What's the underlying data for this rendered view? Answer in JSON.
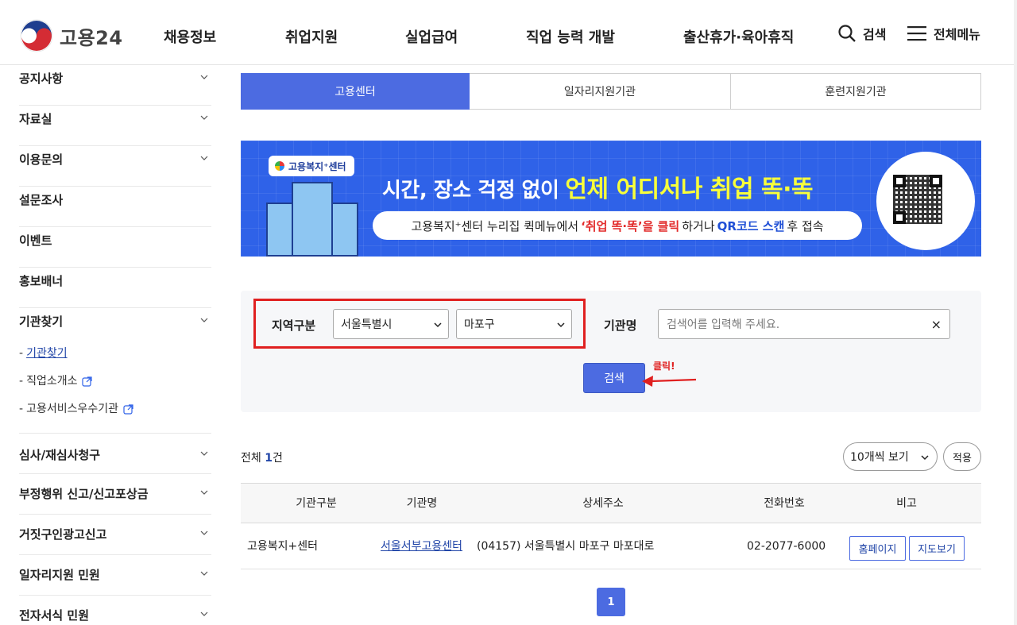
{
  "header": {
    "logo_text": "고용24",
    "nav": [
      "채용정보",
      "취업지원",
      "실업급여",
      "직업 능력 개발",
      "출산휴가·육아휴직"
    ],
    "search_label": "검색",
    "menu_label": "전체메뉴"
  },
  "sidebar": {
    "items": [
      {
        "label": "공지사항"
      },
      {
        "label": "자료실"
      },
      {
        "label": "이용문의"
      },
      {
        "label": "설문조사"
      },
      {
        "label": "이벤트"
      },
      {
        "label": "홍보배너"
      },
      {
        "label": "기관찾기"
      }
    ],
    "sub": [
      {
        "label": "기관찾기"
      },
      {
        "label": "직업소개소"
      },
      {
        "label": "고용서비스우수기관"
      }
    ],
    "items2": [
      {
        "label": "심사/재심사청구"
      },
      {
        "label": "부정행위 신고/신고포상금"
      },
      {
        "label": "거짓구인광고신고"
      },
      {
        "label": "일자리지원 민원"
      },
      {
        "label": "전자서식 민원"
      }
    ]
  },
  "tabs": [
    "고용센터",
    "일자리지원기관",
    "훈련지원기관"
  ],
  "banner": {
    "badge": "고용복지⁺센터",
    "headline_pre": "시간, 장소 걱정 없이",
    "headline_hl": "언제 어디서나 취업 똑·똑",
    "sub_a": "고용복지⁺센터 누리집 퀵메뉴에서",
    "sub_b": "‘취업 똑·똑’을 클릭",
    "sub_c": "하거나",
    "sub_d": "QR코드 스캔",
    "sub_e": "후 접속"
  },
  "search": {
    "region_label": "지역구분",
    "city": "서울특별시",
    "district": "마포구",
    "org_label": "기관명",
    "org_placeholder": "검색어를 입력해 주세요.",
    "clear": "×",
    "button": "검색",
    "click_note": "클릭!"
  },
  "results": {
    "total_prefix": "전체 ",
    "total_count": "1",
    "total_suffix": "건",
    "per_page": "10개씩 보기",
    "apply": "적용"
  },
  "table": {
    "headers": [
      "기관구분",
      "기관명",
      "상세주소",
      "전화번호",
      "비고"
    ],
    "rows": [
      {
        "type": "고용복지+센터",
        "name": "서울서부고용센터",
        "address": "(04157) 서울특별시 마포구 마포대로",
        "phone": "02-2077-6000",
        "btn_home": "홈페이지",
        "btn_map": "지도보기"
      }
    ]
  },
  "pagination": {
    "current": "1"
  },
  "colors": {
    "accent": "#4c6be1",
    "highlight_frame": "#e02020",
    "banner_bg": "#2f62e8"
  }
}
